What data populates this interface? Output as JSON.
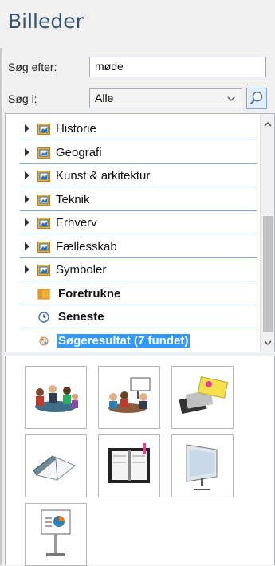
{
  "pane": {
    "title": "Billeder"
  },
  "search": {
    "label": "Søg efter:",
    "value": "møde"
  },
  "scope": {
    "label": "Søg i:",
    "selected": "Alle"
  },
  "search_button": {
    "icon": "magnifier-icon"
  },
  "tree": {
    "items": [
      {
        "label": "Historie",
        "icon": "picture-folder-icon",
        "expandable": true
      },
      {
        "label": "Geografi",
        "icon": "picture-folder-icon",
        "expandable": true
      },
      {
        "label": "Kunst & arkitektur",
        "icon": "picture-folder-icon",
        "expandable": true
      },
      {
        "label": "Teknik",
        "icon": "picture-folder-icon",
        "expandable": true
      },
      {
        "label": "Erhverv",
        "icon": "picture-folder-icon",
        "expandable": true
      },
      {
        "label": "Fællesskab",
        "icon": "picture-folder-icon",
        "expandable": true
      },
      {
        "label": "Symboler",
        "icon": "picture-folder-icon",
        "expandable": true
      },
      {
        "label": "Foretrukne",
        "icon": "favorites-folder-icon",
        "bold": true
      },
      {
        "label": "Seneste",
        "icon": "clock-icon",
        "bold": true
      },
      {
        "label": "Søgeresultat (7 fundet)",
        "icon": "search-result-icon",
        "bold": true,
        "selected": true
      }
    ]
  },
  "results": [
    {
      "name": "meeting-people-icon"
    },
    {
      "name": "meeting-presentation-icon"
    },
    {
      "name": "business-cards-icon"
    },
    {
      "name": "open-book-icon"
    },
    {
      "name": "planner-icon"
    },
    {
      "name": "projection-screen-icon"
    },
    {
      "name": "presentation-board-icon"
    }
  ],
  "colors": {
    "title": "#34536f",
    "selection": "#3399ff",
    "row_divider": "#7fa5cf"
  }
}
